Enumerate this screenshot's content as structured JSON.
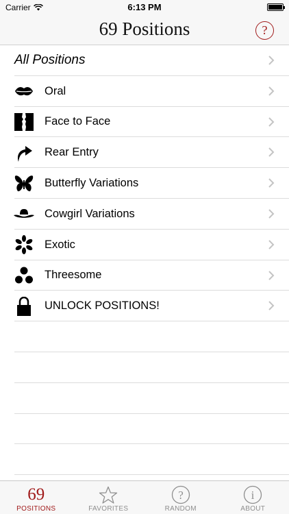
{
  "status": {
    "carrier": "Carrier",
    "time": "6:13 PM"
  },
  "nav": {
    "title": "69 Positions",
    "help_glyph": "?"
  },
  "list": {
    "all_label": "All Positions",
    "items": [
      {
        "label": "Oral",
        "icon": "lips-icon"
      },
      {
        "label": "Face to Face",
        "icon": "faces-icon"
      },
      {
        "label": "Rear Entry",
        "icon": "curved-arrow-icon"
      },
      {
        "label": "Butterfly Variations",
        "icon": "butterfly-icon"
      },
      {
        "label": "Cowgirl Variations",
        "icon": "cowboy-hat-icon"
      },
      {
        "label": "Exotic",
        "icon": "pinwheel-icon"
      },
      {
        "label": "Threesome",
        "icon": "three-dots-icon"
      },
      {
        "label": "UNLOCK POSITIONS!",
        "icon": "lock-icon"
      }
    ]
  },
  "tabs": [
    {
      "label": "POSITIONS",
      "glyph": "69",
      "active": true
    },
    {
      "label": "FAVORITES",
      "icon": "star-icon"
    },
    {
      "label": "RANDOM",
      "glyph": "?",
      "icon": "question-circle-icon"
    },
    {
      "label": "ABOUT",
      "glyph": "i",
      "icon": "info-circle-icon"
    }
  ],
  "colors": {
    "accent": "#a01a1a",
    "inactive": "#8e8e8e",
    "bar_bg": "#f7f7f7"
  }
}
